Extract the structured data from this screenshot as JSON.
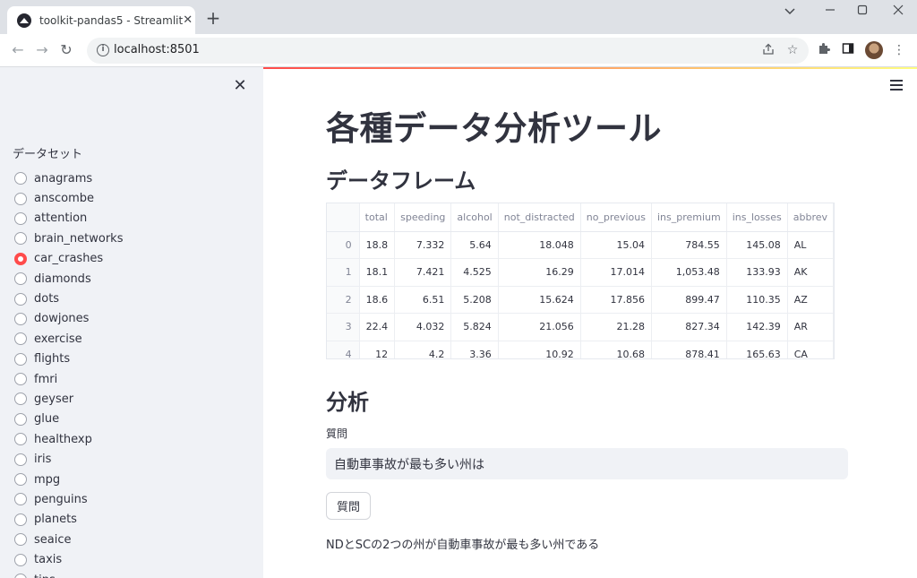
{
  "browser": {
    "tab_title": "toolkit-pandas5 - Streamlit",
    "url": "localhost:8501"
  },
  "sidebar": {
    "radio_label": "データセット",
    "options": [
      {
        "label": "anagrams",
        "checked": false
      },
      {
        "label": "anscombe",
        "checked": false
      },
      {
        "label": "attention",
        "checked": false
      },
      {
        "label": "brain_networks",
        "checked": false
      },
      {
        "label": "car_crashes",
        "checked": true
      },
      {
        "label": "diamonds",
        "checked": false
      },
      {
        "label": "dots",
        "checked": false
      },
      {
        "label": "dowjones",
        "checked": false
      },
      {
        "label": "exercise",
        "checked": false
      },
      {
        "label": "flights",
        "checked": false
      },
      {
        "label": "fmri",
        "checked": false
      },
      {
        "label": "geyser",
        "checked": false
      },
      {
        "label": "glue",
        "checked": false
      },
      {
        "label": "healthexp",
        "checked": false
      },
      {
        "label": "iris",
        "checked": false
      },
      {
        "label": "mpg",
        "checked": false
      },
      {
        "label": "penguins",
        "checked": false
      },
      {
        "label": "planets",
        "checked": false
      },
      {
        "label": "seaice",
        "checked": false
      },
      {
        "label": "taxis",
        "checked": false
      },
      {
        "label": "tips",
        "checked": false
      }
    ]
  },
  "main": {
    "title": "各種データ分析ツール",
    "dataframe_heading": "データフレーム",
    "analysis_heading": "分析",
    "question_label": "質問",
    "question_value": "自動車事故が最も多い州は",
    "button_label": "質問",
    "answer": "NDとSCの2つの州が自動車事故が最も多い州である"
  },
  "dataframe": {
    "columns": [
      "",
      "total",
      "speeding",
      "alcohol",
      "not_distracted",
      "no_previous",
      "ins_premium",
      "ins_losses",
      "abbrev"
    ],
    "rows": [
      [
        "0",
        "18.8",
        "7.332",
        "5.64",
        "18.048",
        "15.04",
        "784.55",
        "145.08",
        "AL"
      ],
      [
        "1",
        "18.1",
        "7.421",
        "4.525",
        "16.29",
        "17.014",
        "1,053.48",
        "133.93",
        "AK"
      ],
      [
        "2",
        "18.6",
        "6.51",
        "5.208",
        "15.624",
        "17.856",
        "899.47",
        "110.35",
        "AZ"
      ],
      [
        "3",
        "22.4",
        "4.032",
        "5.824",
        "21.056",
        "21.28",
        "827.34",
        "142.39",
        "AR"
      ],
      [
        "4",
        "12",
        "4.2",
        "3.36",
        "10.92",
        "10.68",
        "878.41",
        "165.63",
        "CA"
      ]
    ]
  }
}
